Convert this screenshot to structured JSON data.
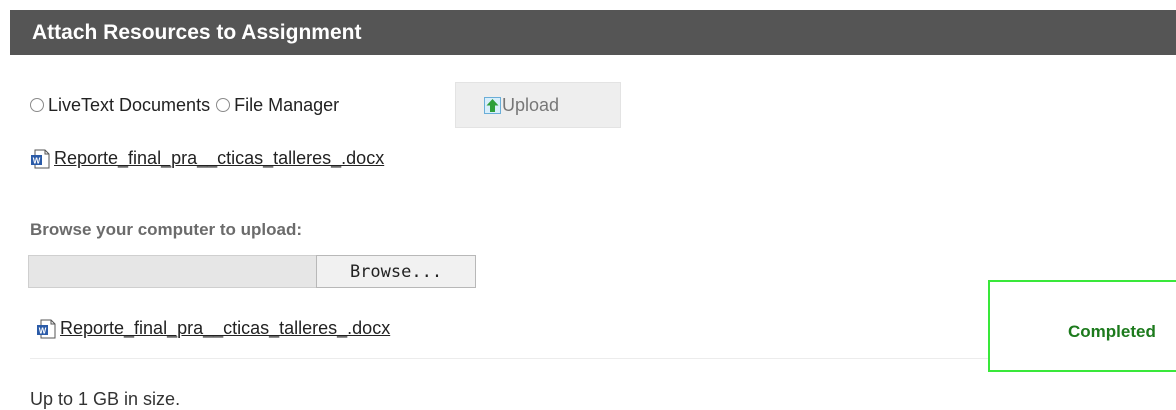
{
  "header": {
    "title": "Attach Resources to Assignment"
  },
  "source_options": [
    {
      "label": "LiveText Documents",
      "selected": false
    },
    {
      "label": "File Manager",
      "selected": false
    }
  ],
  "upload_button": {
    "label": "Upload",
    "icon": "upload-arrow-icon"
  },
  "attached_file": {
    "name": "Reporte_final_pra__cticas_talleres_.docx",
    "icon": "word-document-icon"
  },
  "browse": {
    "label": "Browse your computer to upload:",
    "field_value": "",
    "button_label": "Browse..."
  },
  "uploaded_file": {
    "name": "Reporte_final_pra__cticas_talleres_.docx",
    "icon": "word-document-icon",
    "status": "Completed",
    "status_color": "#1c7a1c",
    "highlight_color": "#39e83a"
  },
  "size_note": "Up to 1 GB in size.",
  "colors": {
    "header_bg": "#555555",
    "header_text": "#ffffff"
  }
}
